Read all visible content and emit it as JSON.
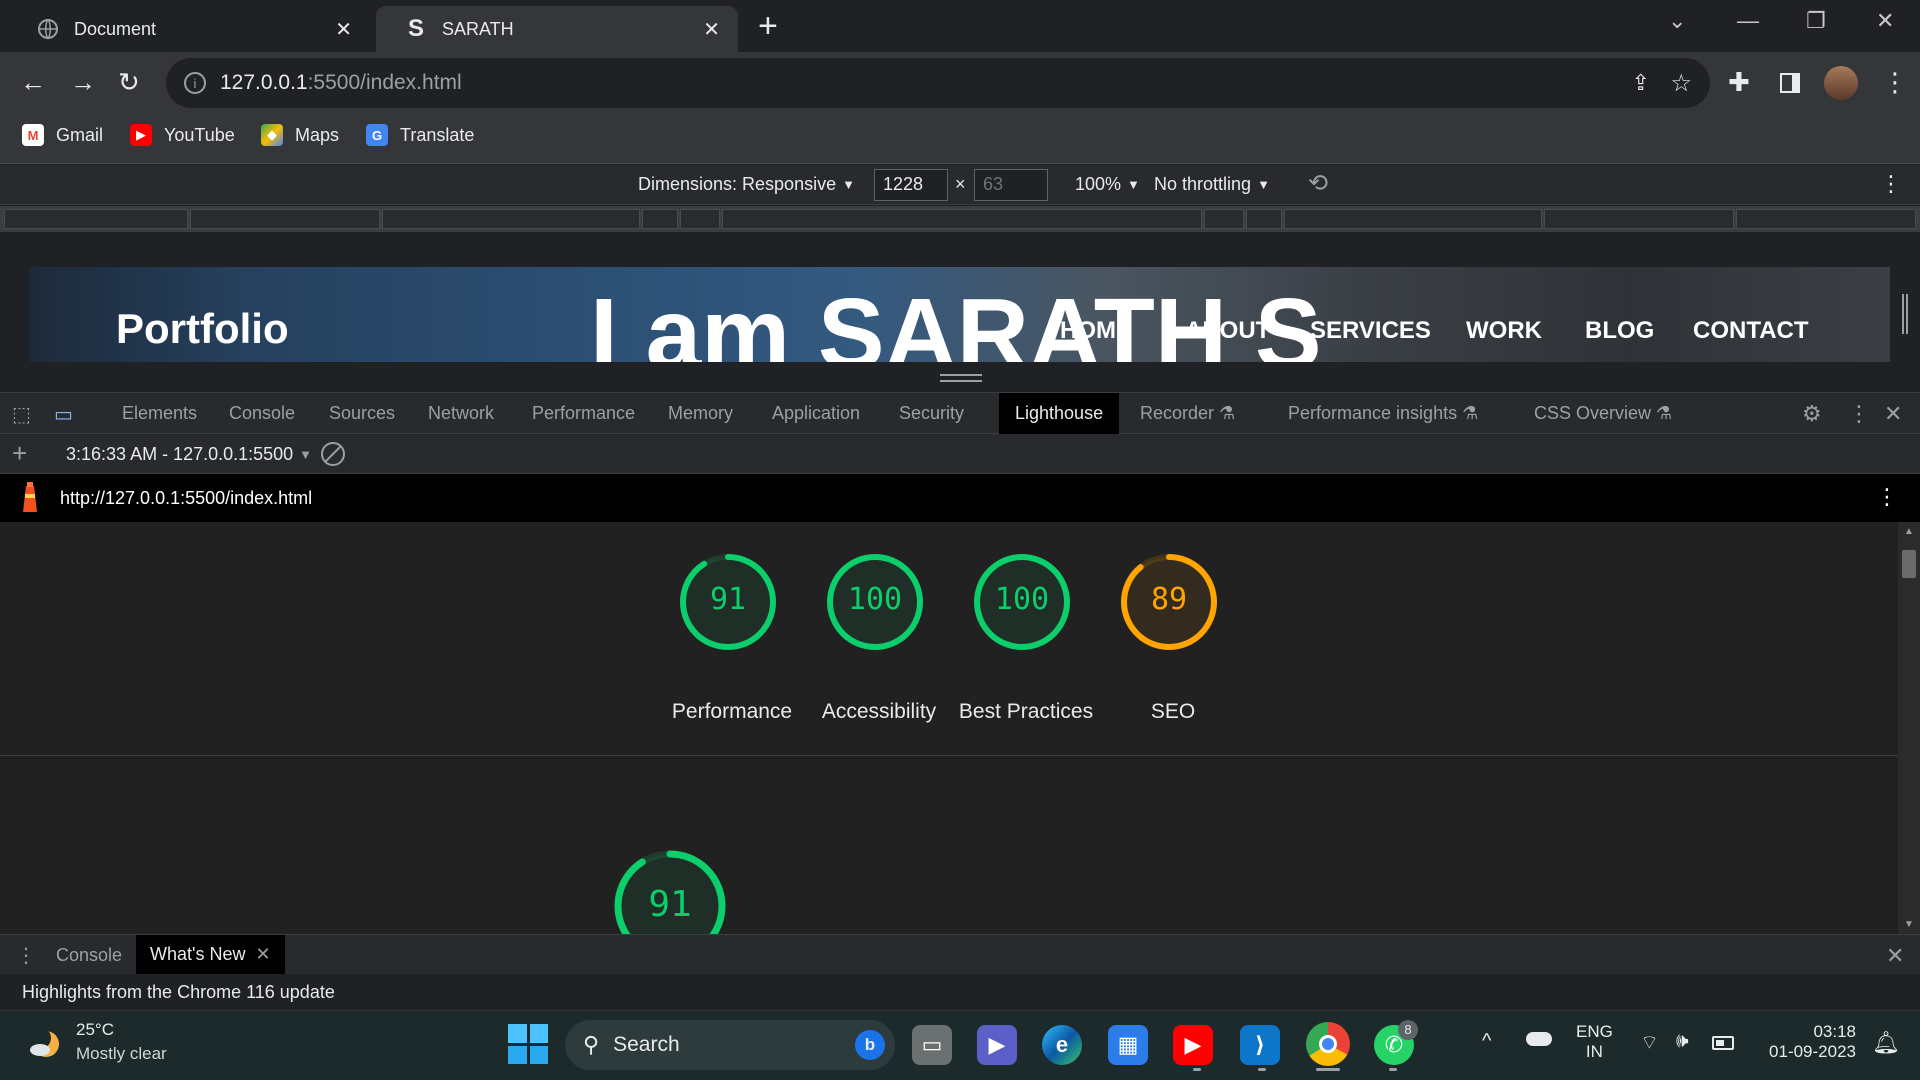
{
  "browser": {
    "tabs": [
      {
        "title": "Document",
        "active": false
      },
      {
        "title": "SARATH",
        "active": true
      }
    ],
    "address": {
      "host": "127.0.0.1",
      "path": ":5500/index.html"
    },
    "bookmarks": [
      {
        "label": "Gmail",
        "icon": "gmail-icon"
      },
      {
        "label": "YouTube",
        "icon": "youtube-icon"
      },
      {
        "label": "Maps",
        "icon": "maps-icon"
      },
      {
        "label": "Translate",
        "icon": "translate-icon"
      }
    ]
  },
  "device_toolbar": {
    "dimensions_label": "Dimensions: Responsive",
    "width": "1228",
    "height": "63",
    "zoom": "100%",
    "throttling": "No throttling"
  },
  "site": {
    "logo": "Portfolio",
    "hero": "I am SARATH S",
    "nav": [
      "HOME",
      "ABOUT",
      "SERVICES",
      "WORK",
      "BLOG",
      "CONTACT"
    ]
  },
  "devtools": {
    "tabs": [
      "Elements",
      "Console",
      "Sources",
      "Network",
      "Performance",
      "Memory",
      "Application",
      "Security",
      "Lighthouse",
      "Recorder",
      "Performance insights",
      "CSS Overview"
    ],
    "active_tab": "Lighthouse",
    "report_select": "3:16:33 AM - 127.0.0.1:5500",
    "report_url": "http://127.0.0.1:5500/index.html",
    "scores": [
      {
        "label": "Performance",
        "value": "91",
        "color": "#0cce6b"
      },
      {
        "label": "Accessibility",
        "value": "100",
        "color": "#0cce6b"
      },
      {
        "label": "Best Practices",
        "value": "100",
        "color": "#0cce6b"
      },
      {
        "label": "SEO",
        "value": "89",
        "color": "#ffa400"
      }
    ],
    "detail_score": {
      "value": "91",
      "color": "#0cce6b"
    },
    "drawer": {
      "tabs": [
        "Console",
        "What's New"
      ],
      "active": "What's New",
      "message": "Highlights from the Chrome 116 update"
    }
  },
  "taskbar": {
    "weather": {
      "temp": "25°C",
      "desc": "Mostly clear"
    },
    "search_placeholder": "Search",
    "whatsapp_badge": "8",
    "lang": {
      "line1": "ENG",
      "line2": "IN"
    },
    "time": "03:18",
    "date": "01-09-2023"
  }
}
